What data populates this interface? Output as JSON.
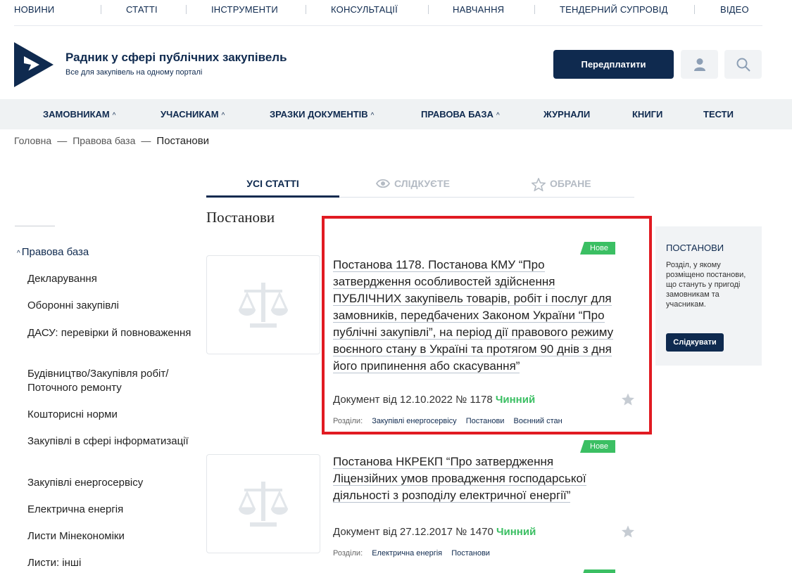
{
  "topnav": [
    "НОВИНИ",
    "СТАТТІ",
    "ІНСТРУМЕНТИ",
    "КОНСУЛЬТАЦІЇ",
    "НАВЧАННЯ",
    "ТЕНДЕРНИЙ СУПРОВІД",
    "ВІДЕО"
  ],
  "brand": {
    "title": "Радник у сфері публічних закупівель",
    "subtitle": "Все для закупівель на одному порталі"
  },
  "header": {
    "subscribe_label": "Передплатити",
    "profile_icon": "user-icon",
    "search_icon": "search-icon"
  },
  "mainnav": [
    {
      "label": "ЗАМОВНИКАМ",
      "chevron": "^"
    },
    {
      "label": "УЧАСНИКАМ",
      "chevron": "^"
    },
    {
      "label": "ЗРАЗКИ ДОКУМЕНТІВ",
      "chevron": "^"
    },
    {
      "label": "ПРАВОВА БАЗА",
      "chevron": "^"
    },
    {
      "label": "ЖУРНАЛИ",
      "chevron": ""
    },
    {
      "label": "КНИГИ",
      "chevron": ""
    },
    {
      "label": "ТЕСТИ",
      "chevron": ""
    }
  ],
  "breadcrumb": {
    "home": "Головна",
    "section": "Правова база",
    "current": "Постанови",
    "separator": "—"
  },
  "tabs": {
    "all": "УСІ СТАТТІ",
    "following": "СЛІДКУЄТЕ",
    "favorites": "ОБРАНЕ"
  },
  "section_title": "Постанови",
  "sidebar": {
    "head": "Правова база",
    "head_chevron": "^",
    "items": [
      "Декларування",
      "Оборонні закупівлі",
      "ДАСУ: перевірки й повноваження",
      "Будівництво/Закупівля робіт/ Поточного ремонту",
      "Кошторисні норми",
      "Закупівлі в сфері інформатизації",
      "Закупівлі енергосервісу",
      "Електрична енергія",
      "Листи Мінекономіки",
      "Листи: інші"
    ]
  },
  "articles": [
    {
      "badge": "Нове",
      "title": "Постанова 1178. Постанова КМУ “Про затвердження особливостей здійснення ПУБЛІЧНИХ закупівель товарів, робіт і послуг для замовників, передбачених Законом України “Про публічні закупівлі”, на період дії правового режиму воєнного стану в Україні та протягом 90 днів з дня його припинення або скасування”",
      "meta": "Документ від 12.10.2022 № 1178",
      "status": "Чинний",
      "tags_label": "Розділи:",
      "tags": [
        "Закупівлі енергосервісу",
        "Постанови",
        "Воєнний стан"
      ]
    },
    {
      "badge": "Нове",
      "title": "Постанова НКРЕКП “Про затвердження Ліцензійних умов провадження господарської діяльності з розподілу електричної енергії”",
      "meta": "Документ від 27.12.2017  № 1470",
      "status": "Чинний",
      "tags_label": "Розділи:",
      "tags": [
        "Електрична енергія",
        "Постанови"
      ]
    }
  ],
  "rightbox": {
    "title": "ПОСТАНОВИ",
    "desc": "Розділ, у якому розміщено постанови, що стануть у пригоді замовникам та учасникам.",
    "button": "Слідкувати"
  },
  "colors": {
    "brand": "#0f2a4f",
    "status": "#3bbf63",
    "highlight": "#e11b22",
    "nav_bg": "#eff2f3"
  }
}
